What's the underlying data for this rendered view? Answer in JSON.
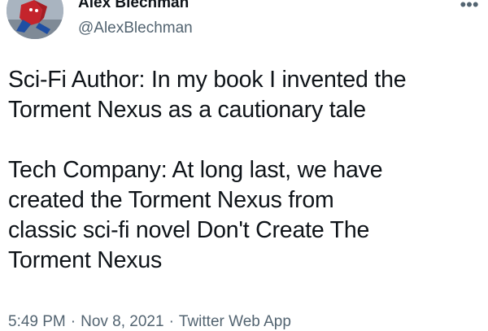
{
  "tweet": {
    "author": {
      "display_name": "Alex Blechman",
      "handle": "@AlexBlechman",
      "avatar_icon": "spiderman-avatar"
    },
    "more_icon": "more-horizontal-icon",
    "more_label": "•••",
    "paragraphs": [
      {
        "lines": [
          "Sci-Fi Author: In my book I invented the",
          "Torment Nexus as a cautionary tale"
        ]
      },
      {
        "lines": [
          "Tech Company: At long last, we have",
          "created the Torment Nexus from",
          "classic sci-fi novel Don't Create The",
          "Torment Nexus"
        ]
      }
    ],
    "meta": {
      "time": "5:49 PM",
      "separator": "·",
      "date": "Nov 8, 2021",
      "source": "Twitter Web App"
    }
  },
  "colors": {
    "text": "#0f1419",
    "secondary": "#536471",
    "background": "#ffffff"
  }
}
